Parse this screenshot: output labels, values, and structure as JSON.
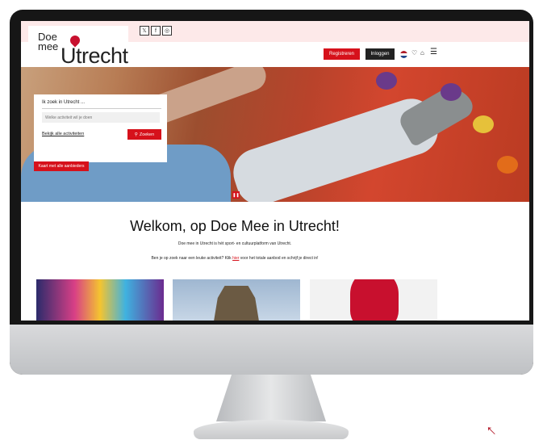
{
  "brand": {
    "logo_line1": "Doe",
    "logo_line2": "mee",
    "logo_in": "in",
    "logo_main": "Utrecht",
    "accent_color": "#d6111b"
  },
  "social_icons": [
    {
      "name": "x-icon",
      "glyph": "𝕏"
    },
    {
      "name": "facebook-icon",
      "glyph": "f"
    },
    {
      "name": "instagram-icon",
      "glyph": "◎"
    }
  ],
  "header": {
    "register_label": "Registreren",
    "login_label": "Inloggen",
    "icons": [
      "dutch-flag-icon",
      "heart-icon",
      "basket-icon",
      "menu-icon"
    ]
  },
  "search": {
    "title": "Ik zoek in Utrecht ...",
    "placeholder": "Welke activiteit wil je doen",
    "all_link": "Bekijk alle activiteiten",
    "button_label": "Zoeken"
  },
  "hero": {
    "map_button": "Kaart met alle aanbieders",
    "pause_glyph": "❚❚"
  },
  "main": {
    "welcome_title": "Welkom, op Doe Mee in Utrecht!",
    "intro_text": "Doe mee in Utrecht is hét sport- en cultuurplatform van Utrecht.",
    "intro2_prefix": "Ben je op zoek naar een leuke activiteit? Klik ",
    "intro2_link": "hier",
    "intro2_suffix": " voor het totale aanbod en schrijf je direct in!"
  }
}
